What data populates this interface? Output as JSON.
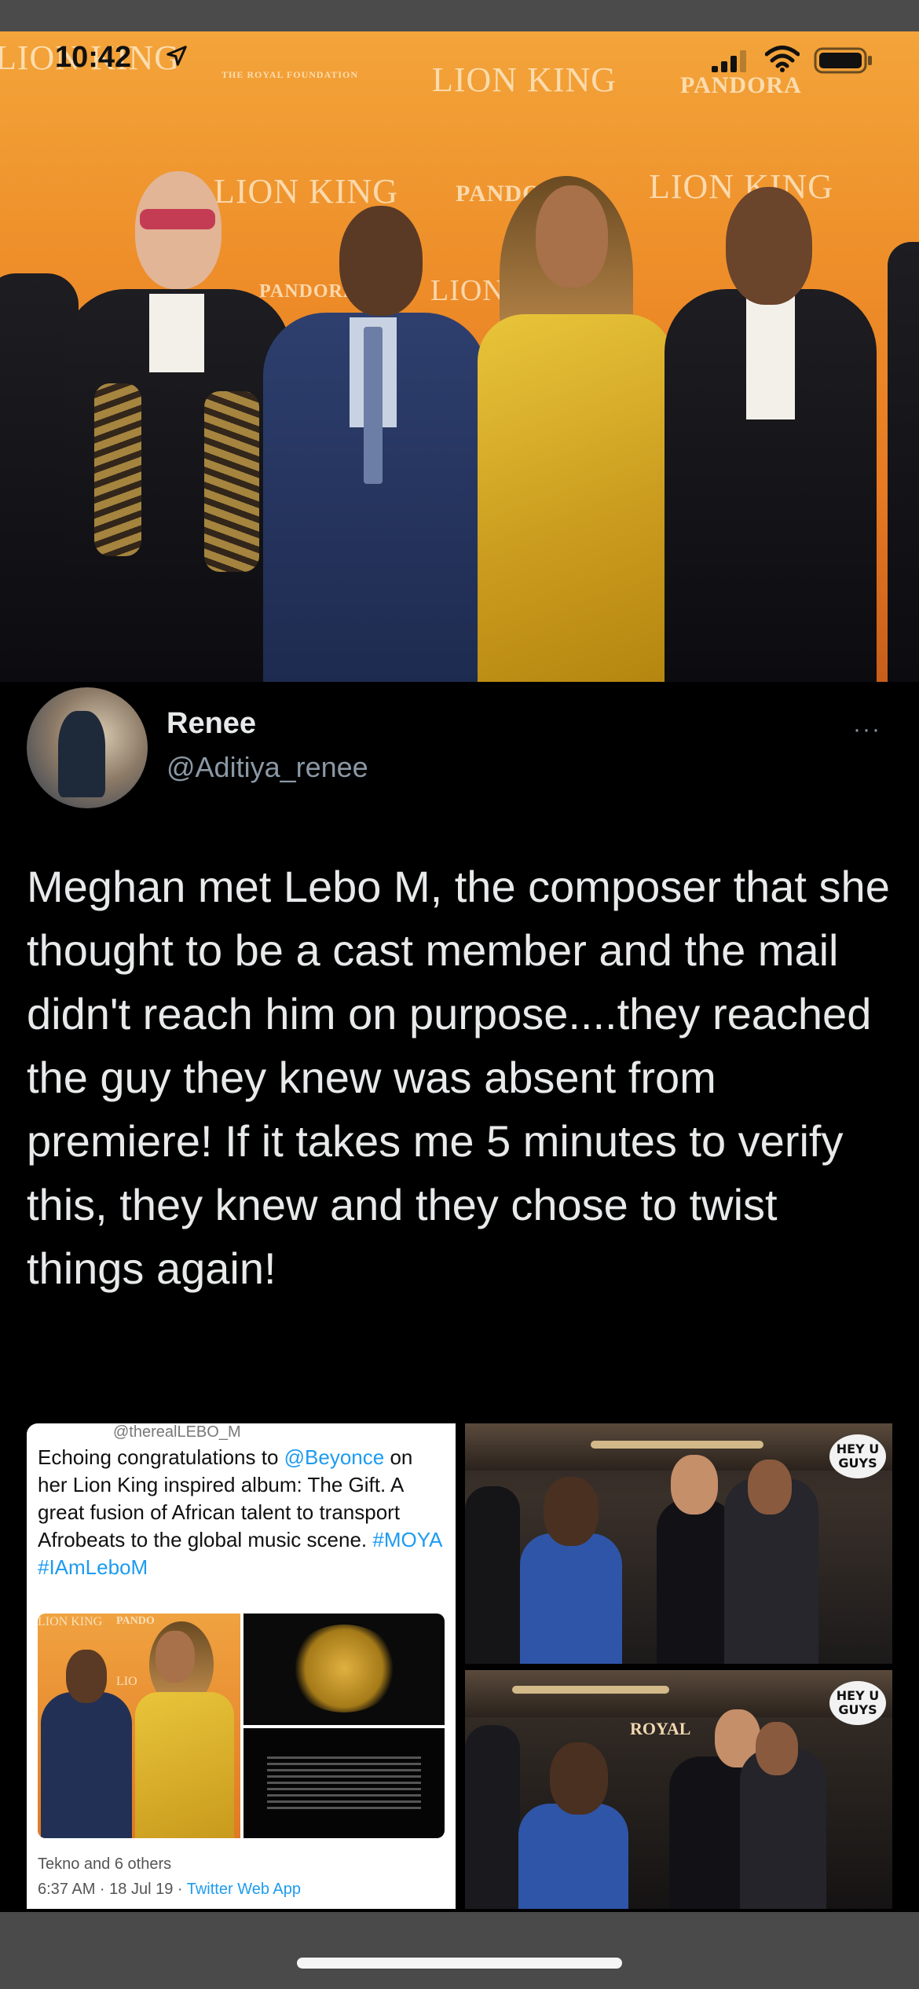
{
  "status_bar": {
    "time": "10:42",
    "icons": [
      "location-arrow-icon",
      "cellular-signal-icon",
      "wifi-icon",
      "battery-icon"
    ]
  },
  "hero_photo": {
    "backdrop_texts": [
      "LION KING",
      "THE ROYAL FOUNDATION",
      "LION KING",
      "PANDORA",
      "LION KING",
      "PANDORA",
      "LION KING",
      "LION",
      "PANDORA"
    ]
  },
  "tweet": {
    "display_name": "Renee",
    "handle": "@Aditiya_renee",
    "more": "···",
    "text": "Meghan met Lebo M, the composer that she thought to be a cast member and the mail didn't reach him on purpose....they reached the guy they knew was absent from premiere! If it takes me 5 minutes to verify this, they knew and they chose to twist things again!"
  },
  "quoted_screenshot": {
    "handle": "@therealLEBO_M",
    "text_before": "Echoing congratulations to ",
    "mention": "@Beyonce",
    "text_after": " on her Lion King inspired album: The Gift. A great fusion of African talent to transport Afrobeats to the global music scene. ",
    "hashtags": "#MOYA #IAmLeboM",
    "image_text": [
      "LION KING",
      "PANDO",
      "LIO"
    ],
    "likes_line": "Tekno and 6 others",
    "time": "6:37 AM · 18 Jul 19 · ",
    "client": "Twitter Web App"
  },
  "right_images": {
    "watermark": "HEY U GUYS",
    "sign_text": "ROYAL"
  },
  "colors": {
    "tweet_bg": "#000000",
    "text_primary": "#e7e9ea",
    "text_secondary": "#8b98a5",
    "link": "#1d9bf0",
    "hero_orange": "#ee8f2a"
  }
}
